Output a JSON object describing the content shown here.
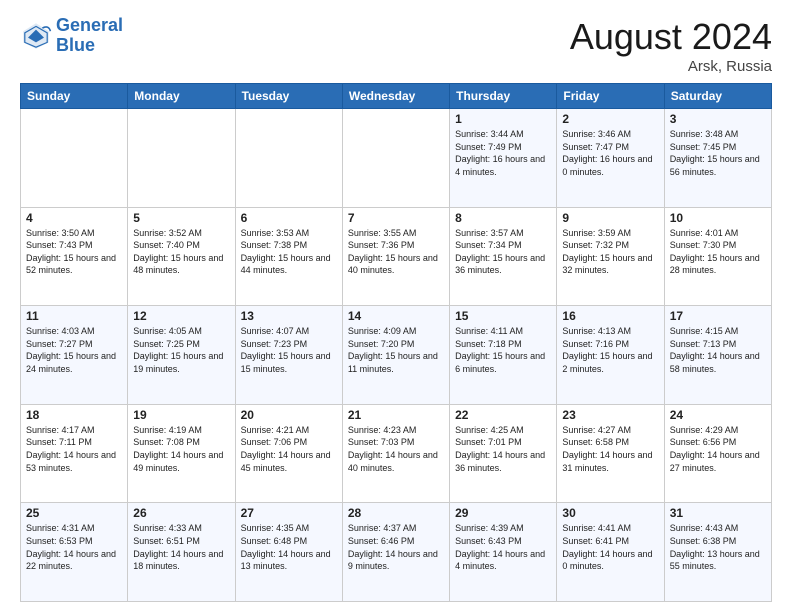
{
  "header": {
    "logo_line1": "General",
    "logo_line2": "Blue",
    "month": "August 2024",
    "location": "Arsk, Russia"
  },
  "weekdays": [
    "Sunday",
    "Monday",
    "Tuesday",
    "Wednesday",
    "Thursday",
    "Friday",
    "Saturday"
  ],
  "weeks": [
    [
      {
        "day": "",
        "info": ""
      },
      {
        "day": "",
        "info": ""
      },
      {
        "day": "",
        "info": ""
      },
      {
        "day": "",
        "info": ""
      },
      {
        "day": "1",
        "info": "Sunrise: 3:44 AM\nSunset: 7:49 PM\nDaylight: 16 hours\nand 4 minutes."
      },
      {
        "day": "2",
        "info": "Sunrise: 3:46 AM\nSunset: 7:47 PM\nDaylight: 16 hours\nand 0 minutes."
      },
      {
        "day": "3",
        "info": "Sunrise: 3:48 AM\nSunset: 7:45 PM\nDaylight: 15 hours\nand 56 minutes."
      }
    ],
    [
      {
        "day": "4",
        "info": "Sunrise: 3:50 AM\nSunset: 7:43 PM\nDaylight: 15 hours\nand 52 minutes."
      },
      {
        "day": "5",
        "info": "Sunrise: 3:52 AM\nSunset: 7:40 PM\nDaylight: 15 hours\nand 48 minutes."
      },
      {
        "day": "6",
        "info": "Sunrise: 3:53 AM\nSunset: 7:38 PM\nDaylight: 15 hours\nand 44 minutes."
      },
      {
        "day": "7",
        "info": "Sunrise: 3:55 AM\nSunset: 7:36 PM\nDaylight: 15 hours\nand 40 minutes."
      },
      {
        "day": "8",
        "info": "Sunrise: 3:57 AM\nSunset: 7:34 PM\nDaylight: 15 hours\nand 36 minutes."
      },
      {
        "day": "9",
        "info": "Sunrise: 3:59 AM\nSunset: 7:32 PM\nDaylight: 15 hours\nand 32 minutes."
      },
      {
        "day": "10",
        "info": "Sunrise: 4:01 AM\nSunset: 7:30 PM\nDaylight: 15 hours\nand 28 minutes."
      }
    ],
    [
      {
        "day": "11",
        "info": "Sunrise: 4:03 AM\nSunset: 7:27 PM\nDaylight: 15 hours\nand 24 minutes."
      },
      {
        "day": "12",
        "info": "Sunrise: 4:05 AM\nSunset: 7:25 PM\nDaylight: 15 hours\nand 19 minutes."
      },
      {
        "day": "13",
        "info": "Sunrise: 4:07 AM\nSunset: 7:23 PM\nDaylight: 15 hours\nand 15 minutes."
      },
      {
        "day": "14",
        "info": "Sunrise: 4:09 AM\nSunset: 7:20 PM\nDaylight: 15 hours\nand 11 minutes."
      },
      {
        "day": "15",
        "info": "Sunrise: 4:11 AM\nSunset: 7:18 PM\nDaylight: 15 hours\nand 6 minutes."
      },
      {
        "day": "16",
        "info": "Sunrise: 4:13 AM\nSunset: 7:16 PM\nDaylight: 15 hours\nand 2 minutes."
      },
      {
        "day": "17",
        "info": "Sunrise: 4:15 AM\nSunset: 7:13 PM\nDaylight: 14 hours\nand 58 minutes."
      }
    ],
    [
      {
        "day": "18",
        "info": "Sunrise: 4:17 AM\nSunset: 7:11 PM\nDaylight: 14 hours\nand 53 minutes."
      },
      {
        "day": "19",
        "info": "Sunrise: 4:19 AM\nSunset: 7:08 PM\nDaylight: 14 hours\nand 49 minutes."
      },
      {
        "day": "20",
        "info": "Sunrise: 4:21 AM\nSunset: 7:06 PM\nDaylight: 14 hours\nand 45 minutes."
      },
      {
        "day": "21",
        "info": "Sunrise: 4:23 AM\nSunset: 7:03 PM\nDaylight: 14 hours\nand 40 minutes."
      },
      {
        "day": "22",
        "info": "Sunrise: 4:25 AM\nSunset: 7:01 PM\nDaylight: 14 hours\nand 36 minutes."
      },
      {
        "day": "23",
        "info": "Sunrise: 4:27 AM\nSunset: 6:58 PM\nDaylight: 14 hours\nand 31 minutes."
      },
      {
        "day": "24",
        "info": "Sunrise: 4:29 AM\nSunset: 6:56 PM\nDaylight: 14 hours\nand 27 minutes."
      }
    ],
    [
      {
        "day": "25",
        "info": "Sunrise: 4:31 AM\nSunset: 6:53 PM\nDaylight: 14 hours\nand 22 minutes."
      },
      {
        "day": "26",
        "info": "Sunrise: 4:33 AM\nSunset: 6:51 PM\nDaylight: 14 hours\nand 18 minutes."
      },
      {
        "day": "27",
        "info": "Sunrise: 4:35 AM\nSunset: 6:48 PM\nDaylight: 14 hours\nand 13 minutes."
      },
      {
        "day": "28",
        "info": "Sunrise: 4:37 AM\nSunset: 6:46 PM\nDaylight: 14 hours\nand 9 minutes."
      },
      {
        "day": "29",
        "info": "Sunrise: 4:39 AM\nSunset: 6:43 PM\nDaylight: 14 hours\nand 4 minutes."
      },
      {
        "day": "30",
        "info": "Sunrise: 4:41 AM\nSunset: 6:41 PM\nDaylight: 14 hours\nand 0 minutes."
      },
      {
        "day": "31",
        "info": "Sunrise: 4:43 AM\nSunset: 6:38 PM\nDaylight: 13 hours\nand 55 minutes."
      }
    ]
  ]
}
